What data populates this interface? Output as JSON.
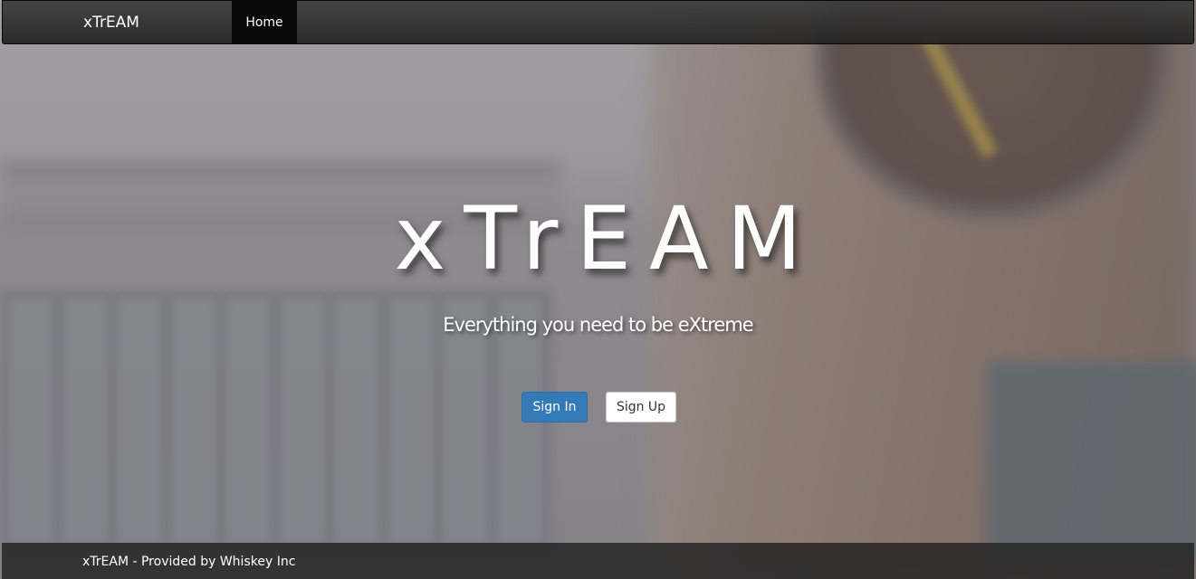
{
  "navbar": {
    "brand": "xTrEAM",
    "items": [
      {
        "label": "Home",
        "active": true
      }
    ]
  },
  "hero": {
    "title": "xTrEAM",
    "subtitle": "Everything you need to be eXtreme",
    "signin_label": "Sign In",
    "signup_label": "Sign Up"
  },
  "footer": {
    "text": "xTrEAM - Provided by Whiskey Inc"
  },
  "colors": {
    "primary_button": "#337ab7",
    "navbar_bg": "#222222",
    "active_nav_bg": "#080808"
  }
}
